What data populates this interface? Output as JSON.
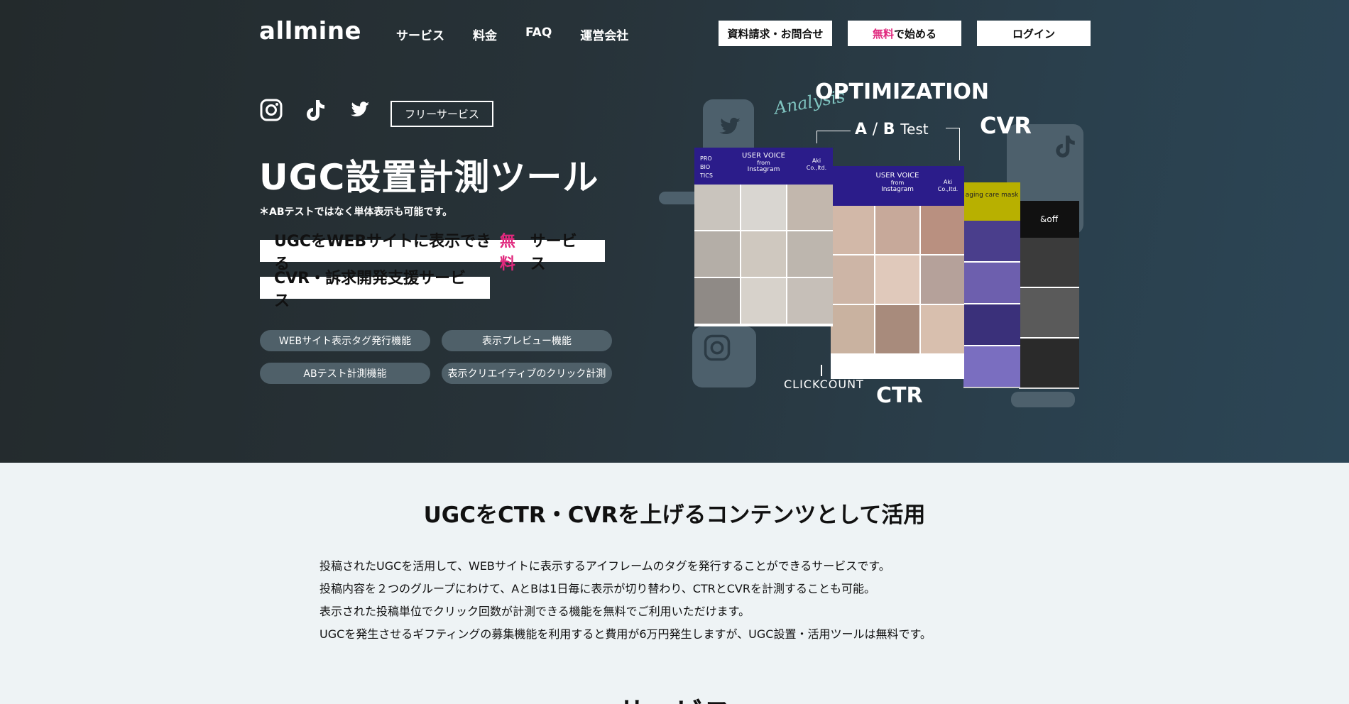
{
  "header": {
    "logo": "allmine",
    "nav": [
      "サービス",
      "料金",
      "FAQ",
      "運営会社"
    ],
    "buttons": {
      "contact": "資料請求・お問合せ",
      "start_pink": "無料",
      "start_rest": "で始める",
      "login": "ログイン"
    }
  },
  "hero": {
    "sns_icons": [
      "instagram-icon",
      "tiktok-icon",
      "twitter-icon"
    ],
    "badge": "フリーサービス",
    "title": "UGC設置計測ツール",
    "note": "＊ABテストではなく単体表示も可能です。",
    "tagline1_a": "UGCをWEBサイトに表示できる",
    "tagline1_pink": "無料",
    "tagline1_b": "サービス",
    "tagline2": "CVR・訴求開発支援サービス",
    "features": [
      "WEBサイト表示タグ発行機能",
      "表示プレビュー機能",
      "ABテスト計測機能",
      "表示クリエイティブのクリック計測"
    ]
  },
  "collage": {
    "optimization": "OPTIMIZATION",
    "analysis": "Analysis",
    "abtest_a": "A",
    "abtest_b": "B",
    "abtest_test": "Test",
    "cvr": "CVR",
    "ctr": "CTR",
    "clickcount": "CLICKCOUNT",
    "card1_head": "USER VOICE",
    "card1_left": "PRO BIO TICS",
    "card1_right": "Aki Co.,ltd.",
    "card2_head": "USER VOICE",
    "card2_right": "Aki Co.,ltd.",
    "card_from": "from",
    "card_instagram": "Instagram",
    "card3_head": "aging care mask",
    "card4_head": "&off"
  },
  "section": {
    "title": "UGCをCTR・CVRを上げるコンテンツとして活用",
    "paragraphs": [
      "投稿されたUGCを活用して、WEBサイトに表示するアイフレームのタグを発行することができるサービスです。",
      "投稿内容を２つのグループにわけて、AとBは1日毎に表示が切り替わり、CTRとCVRを計測することも可能。",
      "表示された投稿単位でクリック回数が計測できる機能を無料でご利用いただけます。",
      "UGCを発生させるギフティングの募集機能を利用すると費用が6万円発生しますが、UGC設置・活用ツールは無料です。"
    ],
    "next_title": "サービス"
  },
  "colors": {
    "accent_pink": "#e0287d",
    "card_header": "#2b1c8a",
    "pill_bg": "#4f6069"
  }
}
